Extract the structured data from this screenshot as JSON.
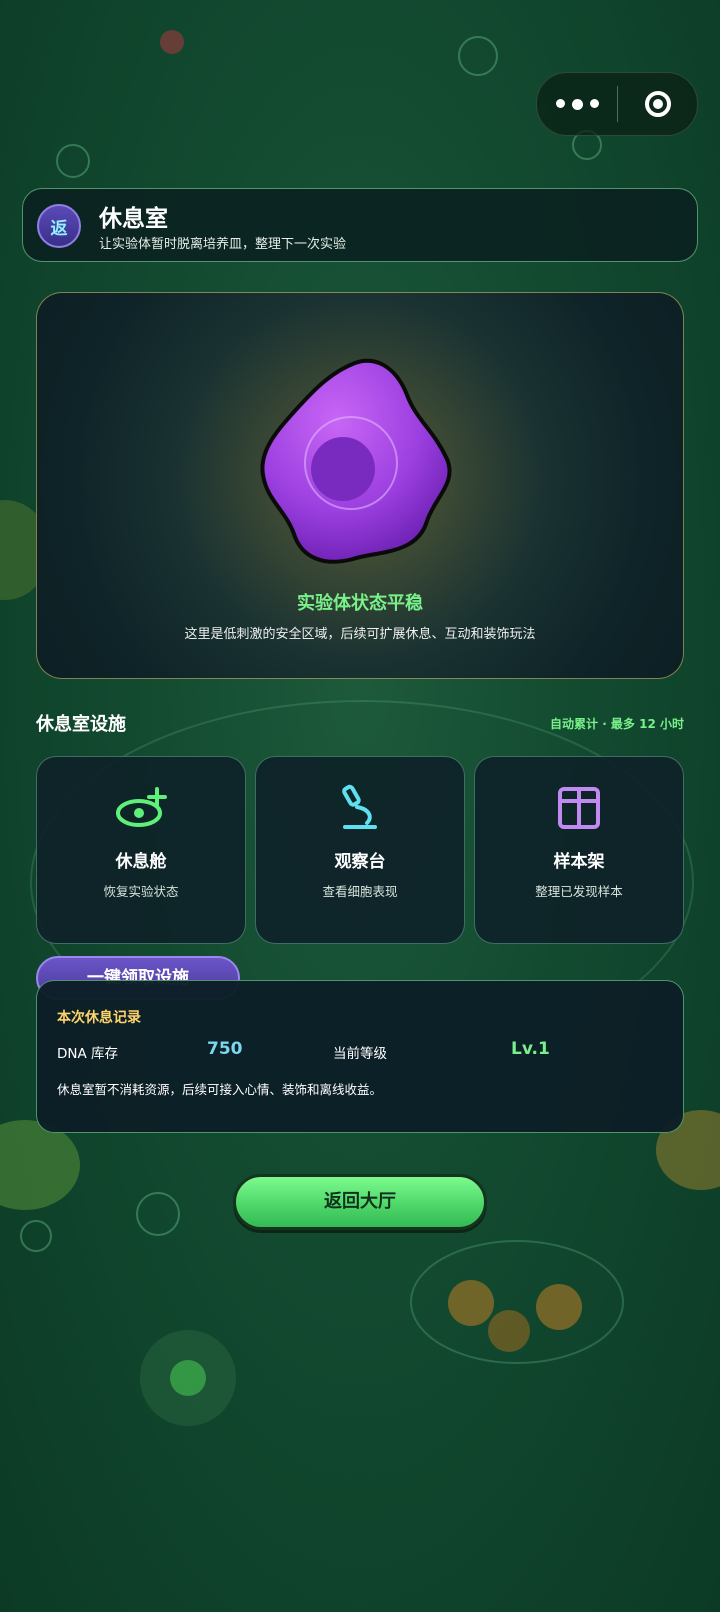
{
  "capsule": {
    "more_icon": "more-dots-icon",
    "close_icon": "target-circle-icon"
  },
  "header": {
    "back_label": "返",
    "title": "休息室",
    "subtitle": "让实验体暂时脱离培养皿，整理下一次实验"
  },
  "status": {
    "title": "实验体状态平稳",
    "description": "这里是低刺激的安全区域，后续可扩展休息、互动和装饰玩法",
    "colors": {
      "cell": "#9b3fe0",
      "title": "#79f08a"
    }
  },
  "facilities": {
    "title": "休息室设施",
    "note": "自动累计 · 最多 12 小时",
    "items": [
      {
        "icon": "rest-pod-icon",
        "name": "休息舱",
        "desc": "恢复实验状态",
        "color": "#5ff07a"
      },
      {
        "icon": "microscope-icon",
        "name": "观察台",
        "desc": "查看细胞表现",
        "color": "#5fe0f0"
      },
      {
        "icon": "box-icon",
        "name": "样本架",
        "desc": "整理已发现样本",
        "color": "#c08af0"
      }
    ],
    "claim_label": "一键领取设施"
  },
  "record": {
    "title": "本次休息记录",
    "dna_label": "DNA 库存",
    "dna_value": "750",
    "level_label": "当前等级",
    "level_value": "Lv.1",
    "note": "休息室暂不消耗资源，后续可接入心情、装饰和离线收益。"
  },
  "return_label": "返回大厅"
}
